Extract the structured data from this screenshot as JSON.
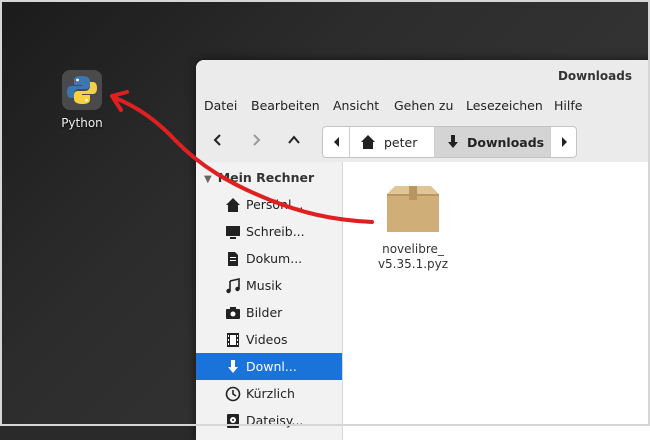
{
  "desktop": {
    "icon_label": "Python",
    "icon_name": "python-logo-icon"
  },
  "window": {
    "title": "Downloads",
    "menu": [
      "Datei",
      "Bearbeiten",
      "Ansicht",
      "Gehen zu",
      "Lesezeichen",
      "Hilfe"
    ],
    "path": {
      "home": "peter",
      "current": "Downloads"
    }
  },
  "sidebar": {
    "header": "Mein Rechner",
    "items": [
      {
        "label": "Persönl...",
        "icon": "home-icon"
      },
      {
        "label": "Schreib...",
        "icon": "desktop-icon"
      },
      {
        "label": "Dokum...",
        "icon": "document-icon"
      },
      {
        "label": "Musik",
        "icon": "music-icon"
      },
      {
        "label": "Bilder",
        "icon": "camera-icon"
      },
      {
        "label": "Videos",
        "icon": "film-icon"
      },
      {
        "label": "Downl...",
        "icon": "download-icon"
      },
      {
        "label": "Kürzlich",
        "icon": "clock-icon"
      },
      {
        "label": "Dateisy...",
        "icon": "drive-icon"
      }
    ],
    "active_index": 6
  },
  "content": {
    "file_name_line1": "novelibre_",
    "file_name_line2": "v5.35.1.pyz",
    "file_icon": "package-icon"
  },
  "colors": {
    "selection": "#1a73d9",
    "annotation_arrow": "#e02020"
  }
}
